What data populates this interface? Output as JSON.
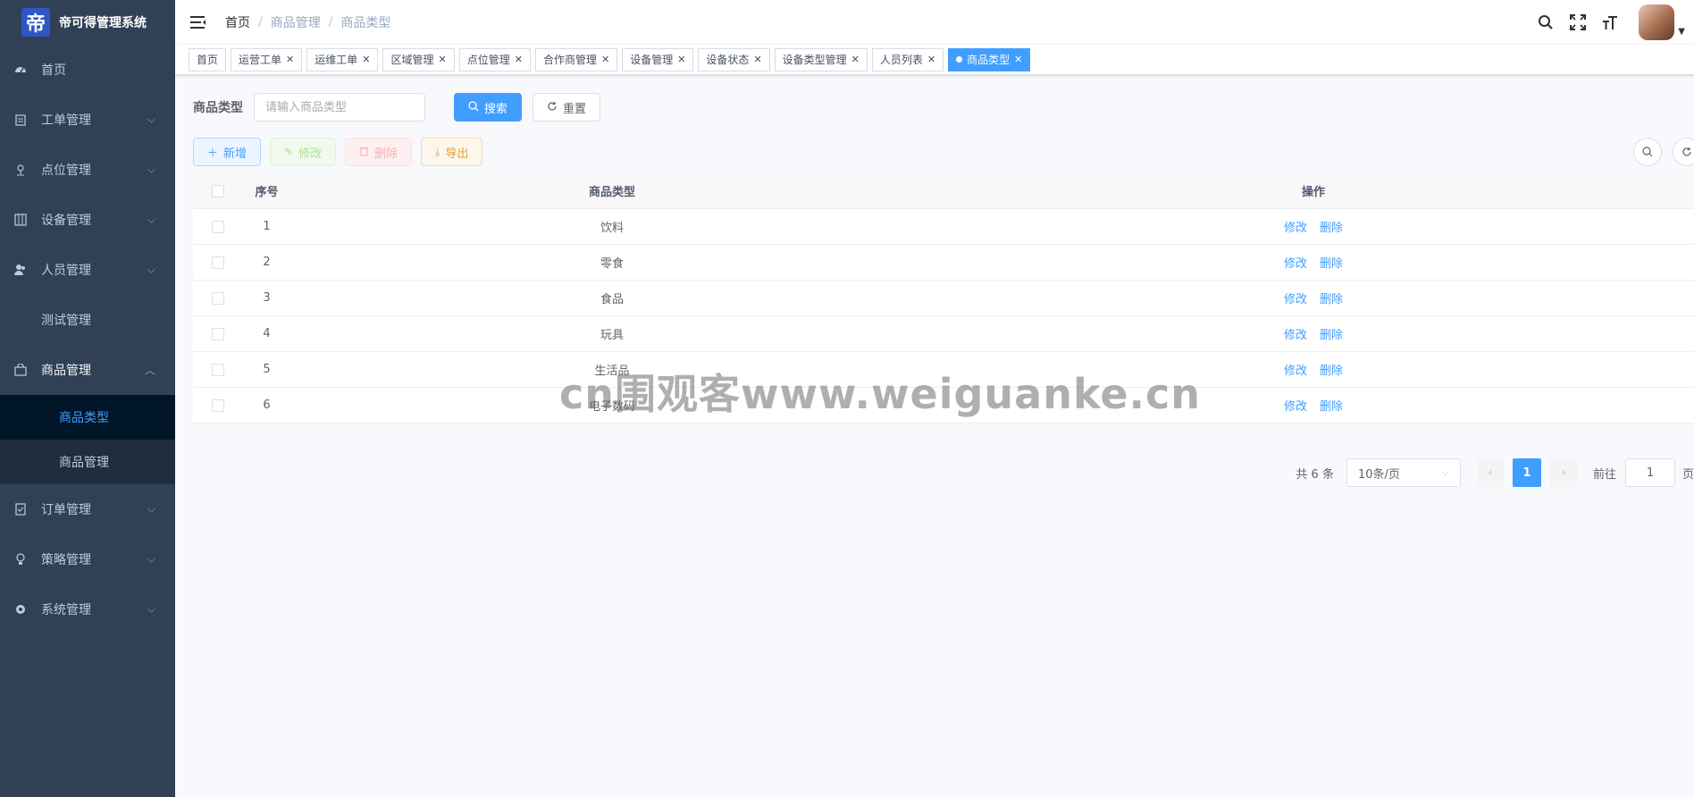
{
  "app": {
    "logo_glyph": "帝",
    "title": "帝可得管理系统"
  },
  "sidebar": {
    "items": [
      {
        "label": "首页",
        "icon": "dashboard-icon"
      },
      {
        "label": "工单管理",
        "icon": "clipboard-icon"
      },
      {
        "label": "点位管理",
        "icon": "location-pin-icon"
      },
      {
        "label": "设备管理",
        "icon": "device-icon"
      },
      {
        "label": "人员管理",
        "icon": "people-icon"
      },
      {
        "label": "测试管理",
        "icon": ""
      },
      {
        "label": "商品管理",
        "icon": "shopping-bag-icon"
      },
      {
        "label": "订单管理",
        "icon": "order-icon"
      },
      {
        "label": "策略管理",
        "icon": "lightbulb-icon"
      },
      {
        "label": "系统管理",
        "icon": "gear-icon"
      }
    ],
    "sub_items": [
      {
        "label": "商品类型",
        "active": true
      },
      {
        "label": "商品管理",
        "active": false
      }
    ]
  },
  "header": {
    "breadcrumb": [
      "首页",
      "商品管理",
      "商品类型"
    ]
  },
  "tags": [
    {
      "label": "首页",
      "closable": false,
      "active": false
    },
    {
      "label": "运营工单",
      "closable": true,
      "active": false
    },
    {
      "label": "运维工单",
      "closable": true,
      "active": false
    },
    {
      "label": "区域管理",
      "closable": true,
      "active": false
    },
    {
      "label": "点位管理",
      "closable": true,
      "active": false
    },
    {
      "label": "合作商管理",
      "closable": true,
      "active": false
    },
    {
      "label": "设备管理",
      "closable": true,
      "active": false
    },
    {
      "label": "设备状态",
      "closable": true,
      "active": false
    },
    {
      "label": "设备类型管理",
      "closable": true,
      "active": false
    },
    {
      "label": "人员列表",
      "closable": true,
      "active": false
    },
    {
      "label": "商品类型",
      "closable": true,
      "active": true
    }
  ],
  "search": {
    "label": "商品类型",
    "placeholder": "请输入商品类型",
    "search_button": "搜索",
    "reset_button": "重置"
  },
  "toolbar": {
    "add": "新增",
    "edit": "修改",
    "delete": "删除",
    "export": "导出"
  },
  "table": {
    "columns": [
      "序号",
      "商品类型",
      "操作"
    ],
    "rows": [
      {
        "index": "1",
        "type": "饮料"
      },
      {
        "index": "2",
        "type": "零食"
      },
      {
        "index": "3",
        "type": "食品"
      },
      {
        "index": "4",
        "type": "玩具"
      },
      {
        "index": "5",
        "type": "生活品"
      },
      {
        "index": "6",
        "type": "电子数码"
      }
    ],
    "row_actions": {
      "edit": "修改",
      "delete": "删除"
    }
  },
  "pagination": {
    "total_text": "共 6 条",
    "page_size": "10条/页",
    "current_page": "1",
    "jump_label": "前往",
    "jump_value": "1",
    "page_suffix": "页"
  },
  "watermark": "cn围观客www.weiguanke.cn",
  "colors": {
    "primary": "#409eff",
    "sidebar_bg": "#304156",
    "sidebar_active_bg": "#001528"
  }
}
